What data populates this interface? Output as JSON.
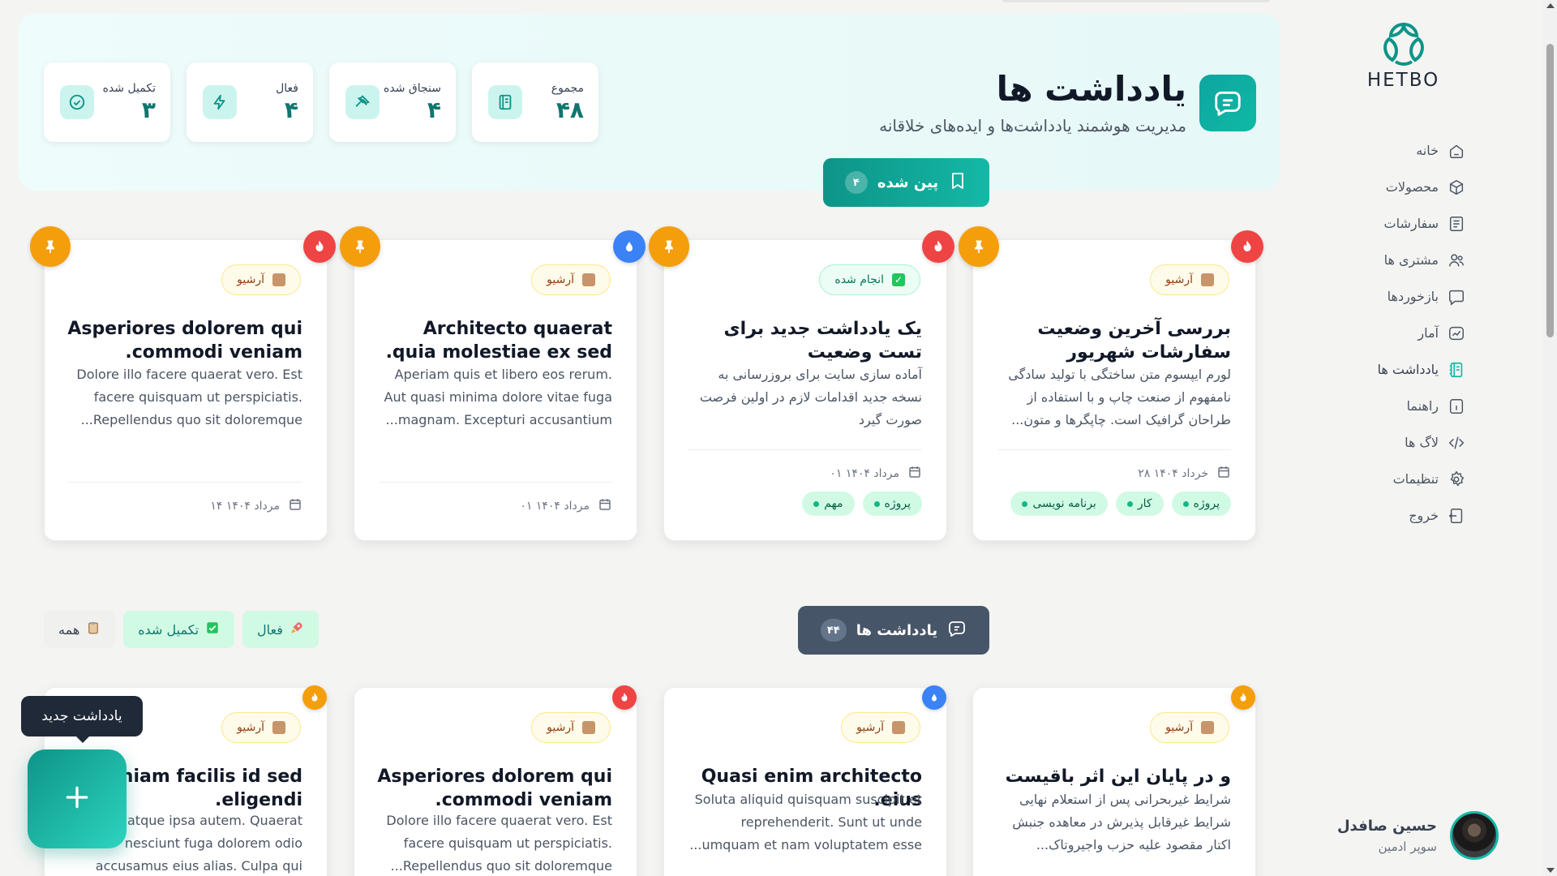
{
  "brand": {
    "name": "HETBO",
    "accent": "#14b8a6"
  },
  "sidebar": {
    "items": [
      {
        "label": "خانه",
        "icon": "home-icon"
      },
      {
        "label": "محصولات",
        "icon": "box-icon"
      },
      {
        "label": "سفارشات",
        "icon": "list-icon"
      },
      {
        "label": "مشتری ها",
        "icon": "users-icon"
      },
      {
        "label": "بازخوردها",
        "icon": "chat-icon"
      },
      {
        "label": "آمار",
        "icon": "chart-icon"
      },
      {
        "label": "یادداشت ها",
        "icon": "notebook-icon"
      },
      {
        "label": "راهنما",
        "icon": "info-icon"
      },
      {
        "label": "لاگ ها",
        "icon": "code-icon"
      },
      {
        "label": "تنظیمات",
        "icon": "gear-icon"
      },
      {
        "label": "خروج",
        "icon": "logout-icon"
      }
    ],
    "user": {
      "name": "حسین صافدل",
      "role": "سوپر ادمین"
    }
  },
  "hero": {
    "title": "یادداشت ها",
    "subtitle": "مدیریت هوشمند یادداشت‌ها و ایده‌های خلاقانه",
    "stats": [
      {
        "label": "تکمیل شده",
        "value": "۳",
        "icon": "check-circle-icon"
      },
      {
        "label": "فعال",
        "value": "۴",
        "icon": "bolt-icon"
      },
      {
        "label": "سنجاق شده",
        "value": "۴",
        "icon": "pin-icon"
      },
      {
        "label": "مجموع",
        "value": "۴۸",
        "icon": "notebook-icon"
      }
    ]
  },
  "pinned_section": {
    "label": "پین شده",
    "count": "۴"
  },
  "notes_section": {
    "label": "یادداشت ها",
    "count": "۴۴"
  },
  "filters": [
    {
      "label": "همه",
      "icon": "clipboard-icon"
    },
    {
      "label": "تکمیل شده",
      "icon": "check-box-icon"
    },
    {
      "label": "فعال",
      "icon": "rocket-icon"
    }
  ],
  "pinned_cards": [
    {
      "badge": "آرشیو",
      "badge_type": "archive",
      "title": "بررسی آخرین وضعیت سفارشات شهریور",
      "body": "لورم ایپسوم متن ساختگی با تولید سادگی نامفهوم از صنعت چاپ و با استفاده از طراحان گرافیک است. چاپگرها و متون...",
      "date": "۲۸ خرداد ۱۴۰۴",
      "tags": [
        "پروژه",
        "کار",
        "برنامه نویسی"
      ],
      "priority": "red"
    },
    {
      "badge": "انجام شده",
      "badge_type": "done",
      "title": "یک یادداشت جدید برای تست وضعیت",
      "body": "آماده سازی سایت برای بروزرسانی به نسخه جدید اقدامات لازم در اولین فرصت صورت گیرد",
      "date": "۰۱ مرداد ۱۴۰۴",
      "tags": [
        "پروژه",
        "مهم"
      ],
      "priority": "red"
    },
    {
      "badge": "آرشیو",
      "badge_type": "archive",
      "title": "Architecto quaerat quia molestiae ex sed.",
      "body": "Aperiam quis et libero eos rerum. Aut quasi minima dolore vitae fuga magnam. Excepturi accusantium...",
      "date": "۰۱ مرداد ۱۴۰۴",
      "tags": [],
      "priority": "blue"
    },
    {
      "badge": "آرشیو",
      "badge_type": "archive",
      "title": "Asperiores dolorem qui commodi veniam.",
      "body": "Dolore illo facere quaerat vero. Est facere quisquam ut perspiciatis. Repellendus quo sit doloremque...",
      "date": "۱۴ مرداد ۱۴۰۴",
      "tags": [],
      "priority": "red"
    }
  ],
  "note_cards": [
    {
      "badge": "آرشیو",
      "title": "و در پایان این اثر باقیست",
      "body": "شرایط غیربحرانی پس از استعلام نهایی شرایط غیرقابل پذیرش در معاهده جنبش اکتار مقصود علیه حزب واجیروتاک...",
      "priority": "orange"
    },
    {
      "badge": "آرشیو",
      "title": "Quasi enim architecto eius.",
      "body": "Soluta aliquid quisquam suscipit et reprehenderit. Sunt ut unde umquam et nam voluptatem esse...",
      "priority": "blue"
    },
    {
      "badge": "آرشیو",
      "title": "Asperiores dolorem qui commodi veniam.",
      "body": "Dolore illo facere quaerat vero. Est facere quisquam ut perspiciatis. Repellendus quo sit doloremque...",
      "priority": "red"
    },
    {
      "badge": "آرشیو",
      "title": "Veniam facilis id sed eligendi.",
      "body": "Qui atque ipsa autem. Quaerat nesciunt fuga dolorem odio accusamus eius alias. Culpa qui sit...",
      "priority": "orange"
    }
  ],
  "fab": {
    "tooltip": "یادداشت جدید",
    "icon": "plus-icon"
  }
}
